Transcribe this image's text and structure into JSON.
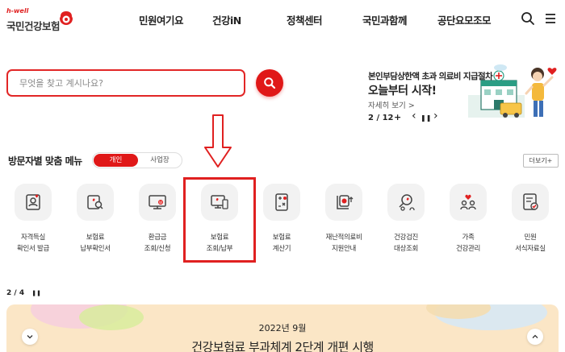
{
  "header": {
    "logo_tag": "h-well",
    "logo_name": "국민건강보험",
    "nav": [
      "민원여기요",
      "건강iN",
      "정책센터",
      "국민과함께",
      "공단요모조모"
    ]
  },
  "search": {
    "placeholder": "무엇을 찾고 계시나요?"
  },
  "banner": {
    "line1": "본인부담상한액 초과 의료비 지급절차",
    "line2": "오늘부터 시작!",
    "more": "자세히 보기 >",
    "pager": "2 / 12",
    "plus": "+",
    "prev": "‹",
    "pause": "❚❚",
    "next": "›"
  },
  "menu": {
    "title": "방문자별 맞춤 메뉴",
    "toggle_personal": "개인",
    "toggle_business": "사업장",
    "more_button": "더보기+",
    "items": [
      {
        "line1": "자격득실",
        "line2": "확인서 발급",
        "icon": "certificate-icon"
      },
      {
        "line1": "보험료",
        "line2": "납부확인서",
        "icon": "receipt-search-icon"
      },
      {
        "line1": "환급금",
        "line2": "조회/신청",
        "icon": "refund-monitor-icon"
      },
      {
        "line1": "보험료",
        "line2": "조회/납부",
        "icon": "payment-monitor-icon"
      },
      {
        "line1": "보험료",
        "line2": "계산기",
        "icon": "calculator-icon"
      },
      {
        "line1": "재난적의료비",
        "line2": "지원안내",
        "icon": "medical-support-icon"
      },
      {
        "line1": "건강검진",
        "line2": "대상조회",
        "icon": "checkup-search-icon"
      },
      {
        "line1": "가족",
        "line2": "건강관리",
        "icon": "family-heart-icon"
      },
      {
        "line1": "민원",
        "line2": "서식자료실",
        "icon": "document-form-icon"
      }
    ]
  },
  "bottom": {
    "pager": "2 / 4",
    "pause": "❚❚",
    "date": "2022년 9월",
    "title": "건강보험료 부과체계 2단계 개편 시행"
  },
  "colors": {
    "accent": "#e01818",
    "highlight_box": "#e02020",
    "banner_bg": "#fbe6c6",
    "icon_bg": "#f2f2f2"
  }
}
